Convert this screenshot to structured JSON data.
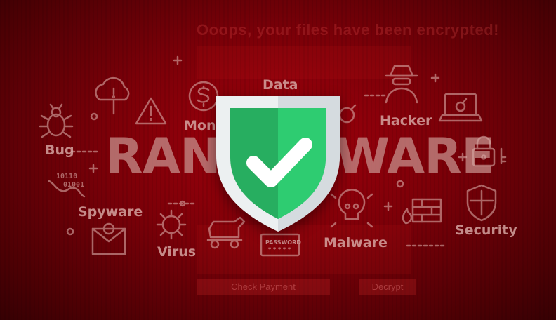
{
  "background": {
    "ghost_title": "Ooops, your files have been encrypted!",
    "ghost_button_left": "Check Payment",
    "ghost_button_right": "Decrypt"
  },
  "word": {
    "left": "RANS",
    "right": "WARE"
  },
  "labels": {
    "data": "Data",
    "money": "Money",
    "hacker": "Hacker",
    "bug": "Bug",
    "spyware": "Spyware",
    "virus": "Virus",
    "malware": "Malware",
    "security": "Security",
    "password": "PASSWORD",
    "password_mask": "* * * * *",
    "binary_line1": "10110",
    "binary_line2": "01001"
  },
  "colors": {
    "background": "#7a0008",
    "shield_green": "#2ecc71",
    "shield_green_dark": "#27ae60",
    "shield_frame": "#ecf0f1",
    "icon_tint": "#d9aaa6"
  },
  "icons": [
    "cloud-alert-icon",
    "warning-icon",
    "money-icon",
    "bug-icon",
    "hacker-icon",
    "laptop-bomb-icon",
    "padlock-icon",
    "crest-shield-icon",
    "skull-icon",
    "firewall-icon",
    "virus-icon",
    "trojan-horse-icon",
    "email-icon",
    "worm-icon",
    "bomb-icon",
    "shield-check-icon"
  ]
}
